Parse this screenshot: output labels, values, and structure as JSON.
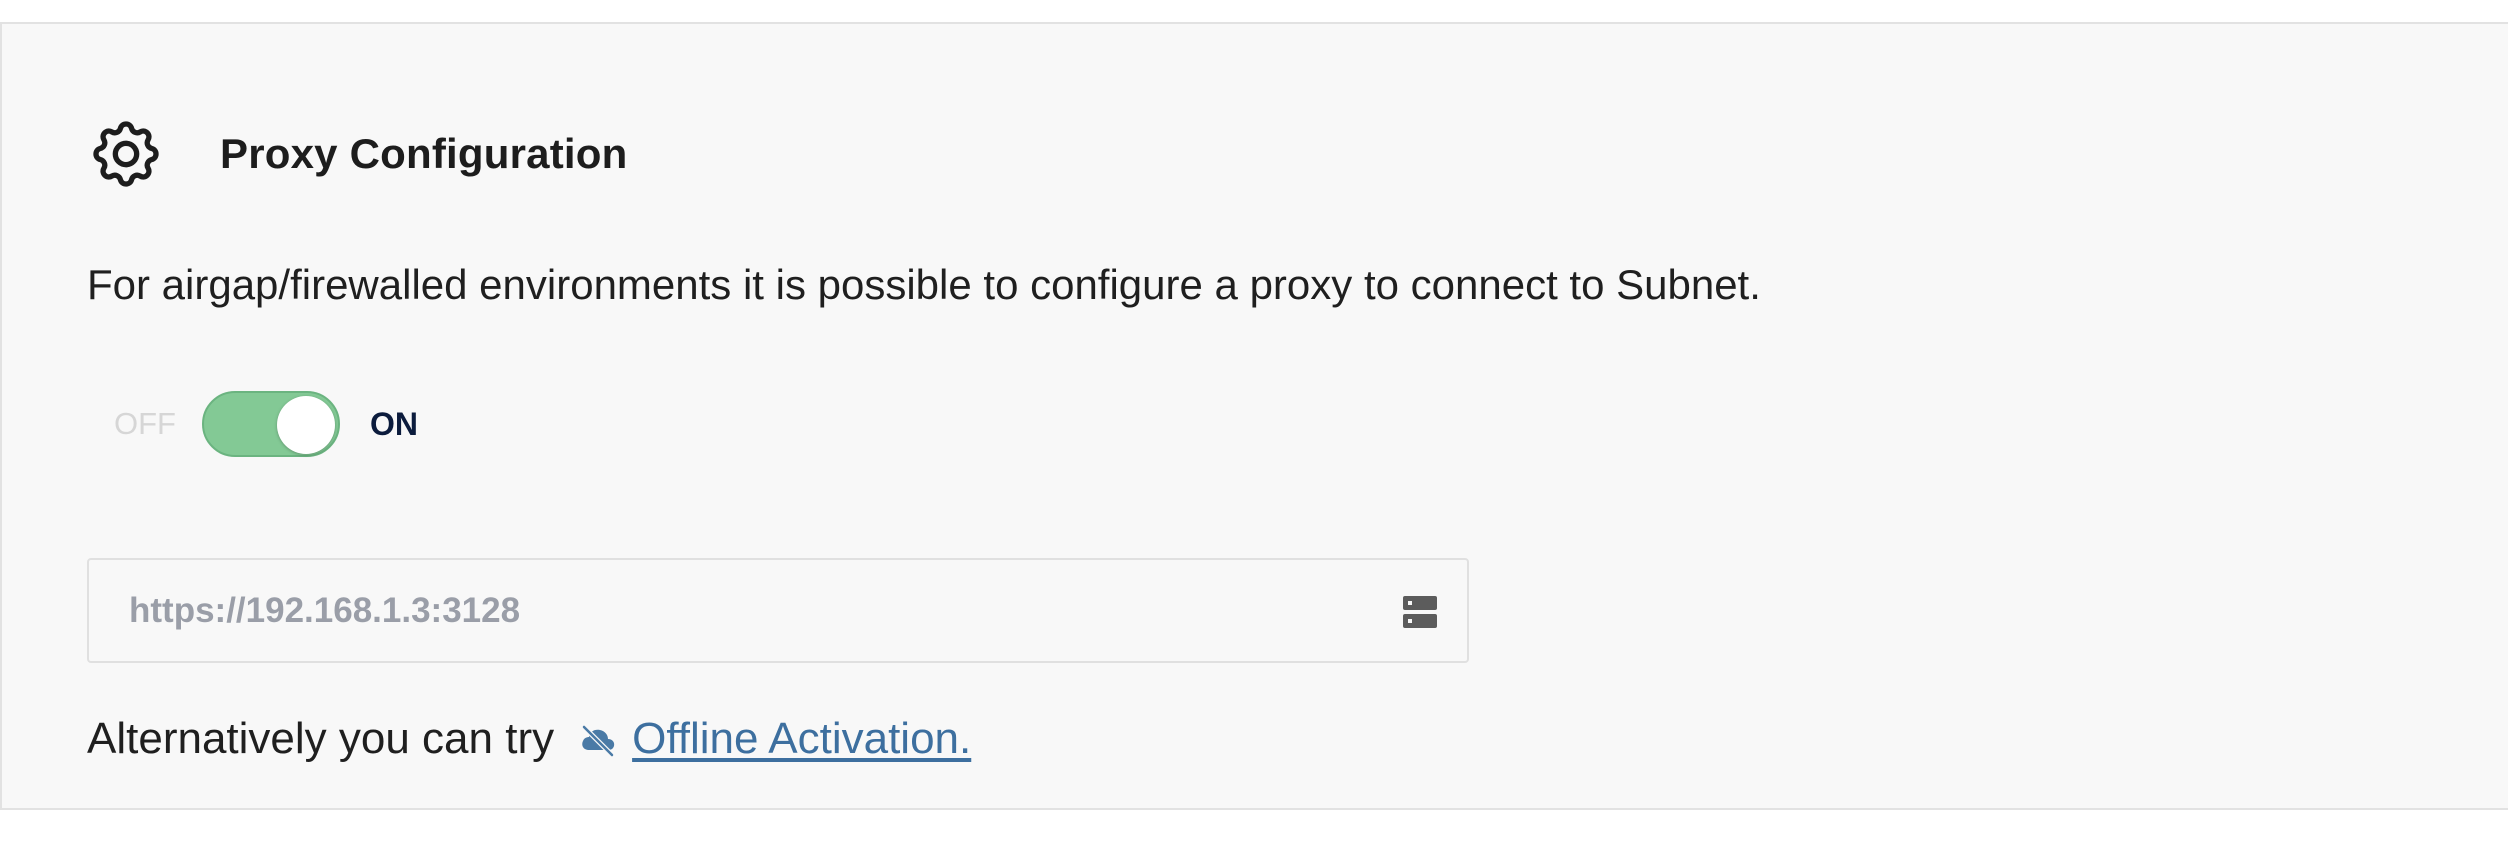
{
  "proxy": {
    "title": "Proxy Configuration",
    "title_icon": "gear-icon",
    "description": "For airgap/firewalled environments it is possible to configure a proxy to connect to Subnet.",
    "toggle": {
      "off_label": "OFF",
      "on_label": "ON",
      "state": "on",
      "color": "#83c995"
    },
    "input": {
      "placeholder": "https://192.168.1.3:3128",
      "value": "",
      "icon": "server-icon"
    },
    "alternative": {
      "text": "Alternatively you can try",
      "link_icon": "cloud-off-icon",
      "link_label": "Offline Activation.",
      "link_color": "#3d6f9f"
    }
  }
}
